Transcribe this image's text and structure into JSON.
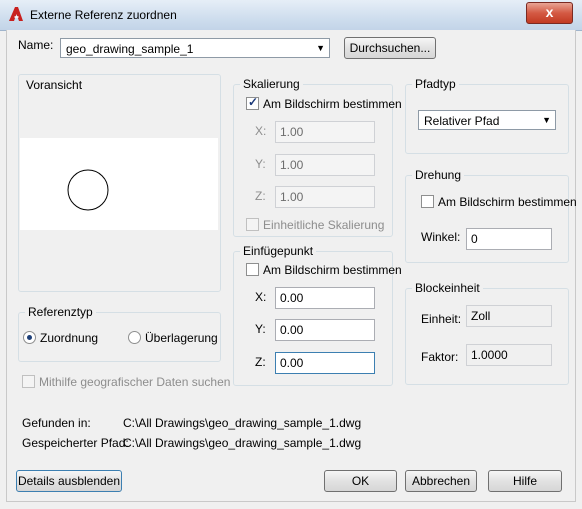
{
  "window": {
    "title": "Externe Referenz zuordnen",
    "close_glyph": "x"
  },
  "name_row": {
    "label": "Name:",
    "value": "geo_drawing_sample_1",
    "browse_label": "Durchsuchen..."
  },
  "preview": {
    "title": "Voransicht"
  },
  "scaling": {
    "title": "Skalierung",
    "specify_on_screen": {
      "label": "Am Bildschirm bestimmen",
      "checked": true
    },
    "x": {
      "label": "X:",
      "value": "1.00"
    },
    "y": {
      "label": "Y:",
      "value": "1.00"
    },
    "z": {
      "label": "Z:",
      "value": "1.00"
    },
    "uniform": {
      "label": "Einheitliche Skalierung",
      "checked": false
    }
  },
  "path_type": {
    "title": "Pfadtyp",
    "value": "Relativer Pfad"
  },
  "rotation": {
    "title": "Drehung",
    "specify_on_screen": {
      "label": "Am Bildschirm bestimmen",
      "checked": false
    },
    "angle_label": "Winkel:",
    "angle_value": "0"
  },
  "insertion_point": {
    "title": "Einfügepunkt",
    "specify_on_screen": {
      "label": "Am Bildschirm bestimmen",
      "checked": false
    },
    "x": {
      "label": "X:",
      "value": "0.00"
    },
    "y": {
      "label": "Y:",
      "value": "0.00"
    },
    "z": {
      "label": "Z:",
      "value": "0.00"
    }
  },
  "block_unit": {
    "title": "Blockeinheit",
    "unit_label": "Einheit:",
    "unit_value": "Zoll",
    "factor_label": "Faktor:",
    "factor_value": "1.0000"
  },
  "reference_type": {
    "title": "Referenztyp",
    "attach_label": "Zuordnung",
    "overlay_label": "Überlagerung",
    "selected": "attach"
  },
  "geo_data": {
    "label": "Mithilfe geografischer Daten suchen",
    "checked": false
  },
  "found_in": {
    "label": "Gefunden in:",
    "value": "C:\\All Drawings\\geo_drawing_sample_1.dwg"
  },
  "saved_path": {
    "label": "Gespeicherter Pfad:",
    "value": "C:\\All Drawings\\geo_drawing_sample_1.dwg"
  },
  "buttons": {
    "details": "Details ausblenden",
    "ok": "OK",
    "cancel": "Abbrechen",
    "help": "Hilfe"
  },
  "colors": {
    "accent": "#1e3f78",
    "app_icon": "#c8201e"
  }
}
